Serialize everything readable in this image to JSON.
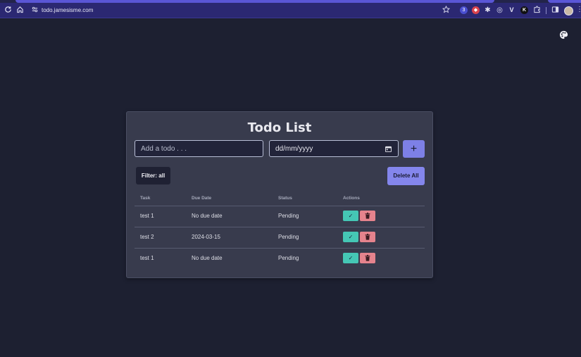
{
  "browser": {
    "url": "todo.jamesisme.com",
    "icons": {
      "reload": "reload-icon",
      "home": "home-icon",
      "site_settings": "site-settings-icon",
      "bookmark": "star-icon",
      "extensions": "puzzle-icon",
      "sidebar": "sidebar-icon",
      "menu": "kebab-menu-icon"
    },
    "extensions": [
      {
        "name": "ext-badge-icon",
        "glyph": "3",
        "color": "#4a4fd1"
      },
      {
        "name": "ext-shield-icon",
        "glyph": "◆",
        "color": "#d9434e"
      },
      {
        "name": "ext-sparkle-icon",
        "glyph": "✱",
        "color": "#2f2d7f"
      },
      {
        "name": "ext-circle-icon",
        "glyph": "◎",
        "color": "#2f2d7f"
      },
      {
        "name": "ext-v-icon",
        "glyph": "V",
        "color": "#2f2d7f"
      },
      {
        "name": "ext-k-icon",
        "glyph": "K",
        "color": "#111111"
      }
    ]
  },
  "page": {
    "theme_icon": "palette-icon",
    "title": "Todo List",
    "input_placeholder": "Add a todo . . .",
    "date_placeholder": "dd/mm/yyyy",
    "add_label": "+",
    "filter_label": "Filter: all",
    "delete_all_label": "Delete All",
    "columns": [
      "Task",
      "Due Date",
      "Status",
      "Actions"
    ],
    "rows": [
      {
        "task": "test 1",
        "due": "No due date",
        "status": "Pending"
      },
      {
        "task": "test 2",
        "due": "2024-03-15",
        "status": "Pending"
      },
      {
        "task": "test 1",
        "due": "No due date",
        "status": "Pending"
      }
    ],
    "action_icons": {
      "done": "check-icon",
      "delete": "trash-icon"
    }
  },
  "colors": {
    "background": "#1d2031",
    "card": "#383b4d",
    "accent": "#7d80e6",
    "done": "#45c7b5",
    "delete": "#e5838d"
  }
}
